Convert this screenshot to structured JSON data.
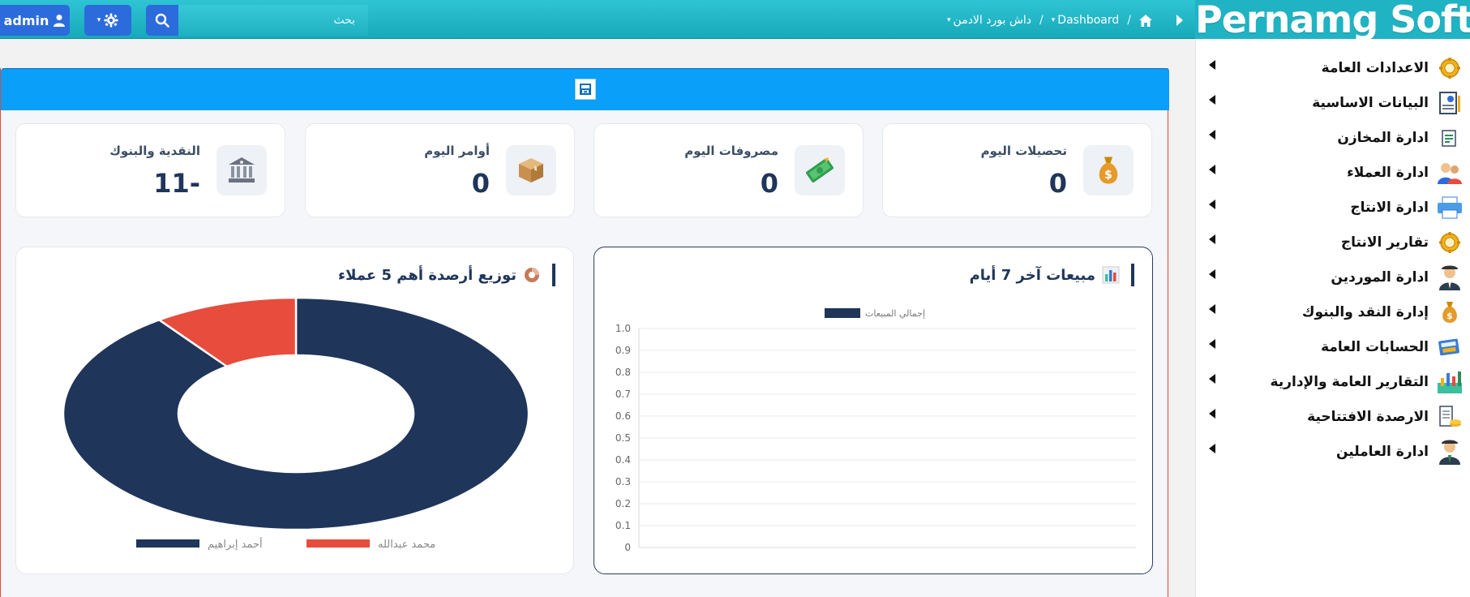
{
  "topbar": {
    "admin_label": "admin",
    "search_placeholder": "بحث",
    "breadcrumb": {
      "dashboard_label": "Dashboard",
      "admin_dash_label": "داش بورد الادمن"
    },
    "brand": "Pernamg Soft"
  },
  "sidebar": {
    "items": [
      {
        "label": "الاعدادات العامة",
        "icon": "gear-icon"
      },
      {
        "label": "البيانات الاساسية",
        "icon": "report-icon"
      },
      {
        "label": "ادارة المخازن",
        "icon": "clipboard-icon"
      },
      {
        "label": "ادارة العملاء",
        "icon": "users-icon"
      },
      {
        "label": "ادارة الانتاج",
        "icon": "printer-icon"
      },
      {
        "label": "تقارير الانتاج",
        "icon": "gear-icon"
      },
      {
        "label": "ادارة الموردين",
        "icon": "supplier-icon"
      },
      {
        "label": "إدارة النقد والبنوك",
        "icon": "money-bag-icon"
      },
      {
        "label": "الحسابات العامة",
        "icon": "calculator-icon"
      },
      {
        "label": "التقارير العامة والإدارية",
        "icon": "chart-icon"
      },
      {
        "label": "الارصدة الافتتاحية",
        "icon": "ledger-icon"
      },
      {
        "label": "ادارة العاملين",
        "icon": "worker-icon"
      }
    ]
  },
  "stats": [
    {
      "label": "تحصيلات اليوم",
      "value": "0",
      "icon": "money-bag-icon"
    },
    {
      "label": "مصروفات اليوم",
      "value": "0",
      "icon": "cash-icon"
    },
    {
      "label": "أوامر اليوم",
      "value": "0",
      "icon": "box-icon"
    },
    {
      "label": "النقدية والبنوك",
      "value": "-11",
      "icon": "bank-icon"
    }
  ],
  "sales_card": {
    "title": "مبيعات آخر 7 أيام"
  },
  "pie_card": {
    "title": "توزيع أرصدة أهم 5 عملاء"
  },
  "colors": {
    "navy": "#1f355a",
    "red": "#e74c3c",
    "teal": "#1fb1c1",
    "blue": "#0a9ff8"
  },
  "chart_data": [
    {
      "type": "line",
      "series": [
        {
          "name": "إجمالي المبيعات",
          "values": []
        }
      ],
      "ylim": [
        0,
        1
      ],
      "yticks": [
        0,
        0.1,
        0.2,
        0.3,
        0.4,
        0.5,
        0.6,
        0.7,
        0.8,
        0.9,
        1.0
      ],
      "ytick_labels": [
        "0",
        "0.1",
        "0.2",
        "0.3",
        "0.4",
        "0.5",
        "0.6",
        "0.7",
        "0.8",
        "0.9",
        "1.0"
      ],
      "grid": true,
      "legend": "top"
    },
    {
      "type": "pie",
      "categories": [
        "أحمد إبراهيم",
        "محمد عبدالله"
      ],
      "values": [
        90,
        10
      ],
      "colors": [
        "#1f355a",
        "#e74c3c"
      ],
      "legend": "bottom"
    }
  ]
}
